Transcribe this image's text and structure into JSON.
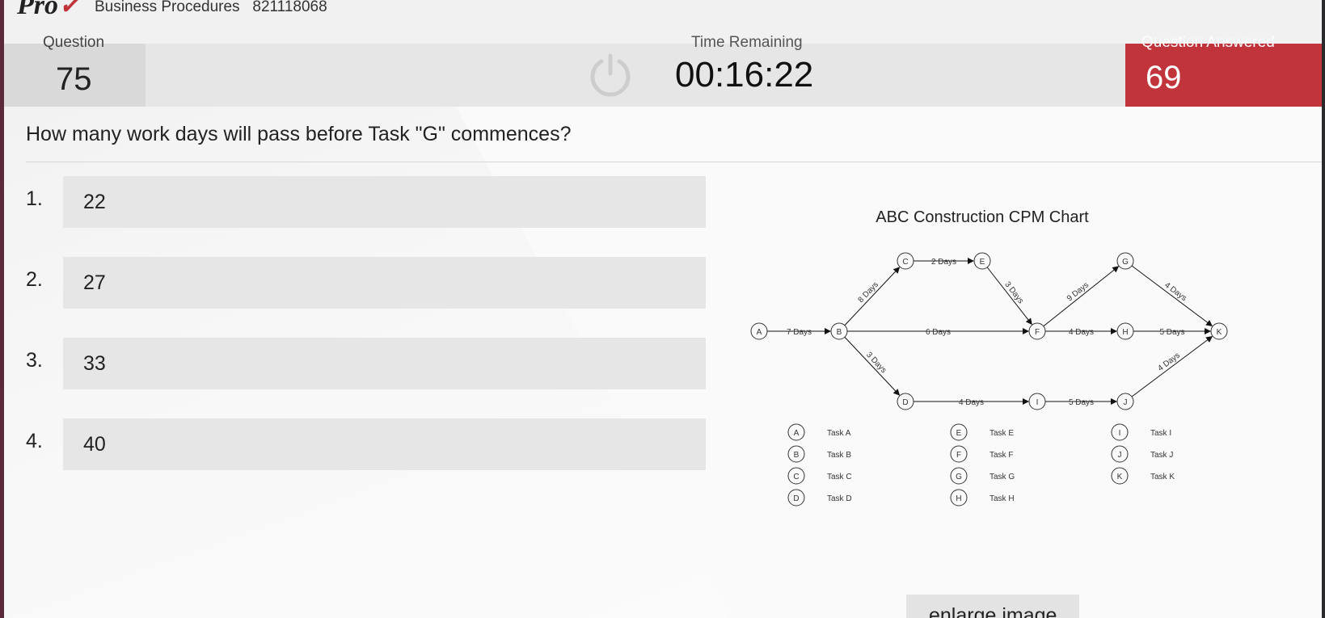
{
  "header": {
    "logo": "Pro",
    "exam_name": "Business Procedures   821118068"
  },
  "status": {
    "question_label": "Question",
    "question_number": "75",
    "time_label": "Time Remaining",
    "time_remaining": "00:16:22",
    "answered_label": "Question Answered",
    "answered_count": "69",
    "answered_color": "#c1343b"
  },
  "question": {
    "text": "How many work days will pass before Task \"G\" commences?"
  },
  "options": [
    {
      "num": "1.",
      "text": "22"
    },
    {
      "num": "2.",
      "text": "27"
    },
    {
      "num": "3.",
      "text": "33"
    },
    {
      "num": "4.",
      "text": "40"
    }
  ],
  "diagram": {
    "title": "ABC Construction CPM Chart",
    "nodes": [
      "A",
      "B",
      "C",
      "D",
      "E",
      "F",
      "G",
      "H",
      "I",
      "J",
      "K"
    ],
    "edges": [
      {
        "from": "A",
        "to": "B",
        "label": "7 Days"
      },
      {
        "from": "B",
        "to": "C",
        "label": "8 Days"
      },
      {
        "from": "B",
        "to": "F",
        "label": "6 Days"
      },
      {
        "from": "B",
        "to": "D",
        "label": "3 Days"
      },
      {
        "from": "C",
        "to": "E",
        "label": "2 Days"
      },
      {
        "from": "E",
        "to": "F",
        "label": "3 Days"
      },
      {
        "from": "F",
        "to": "G",
        "label": "9 Days"
      },
      {
        "from": "F",
        "to": "H",
        "label": "4 Days"
      },
      {
        "from": "G",
        "to": "K",
        "label": "4 Days"
      },
      {
        "from": "H",
        "to": "K",
        "label": "5 Days"
      },
      {
        "from": "D",
        "to": "I",
        "label": "4 Days"
      },
      {
        "from": "I",
        "to": "J",
        "label": "5 Days"
      },
      {
        "from": "J",
        "to": "K",
        "label": "4 Days"
      }
    ],
    "legend": [
      {
        "node": "A",
        "label": "Task A"
      },
      {
        "node": "B",
        "label": "Task B"
      },
      {
        "node": "C",
        "label": "Task C"
      },
      {
        "node": "D",
        "label": "Task D"
      },
      {
        "node": "E",
        "label": "Task E"
      },
      {
        "node": "F",
        "label": "Task F"
      },
      {
        "node": "G",
        "label": "Task G"
      },
      {
        "node": "H",
        "label": "Task H"
      },
      {
        "node": "I",
        "label": "Task I"
      },
      {
        "node": "J",
        "label": "Task J"
      },
      {
        "node": "K",
        "label": "Task K"
      }
    ]
  },
  "enlarge_button": "enlarge image"
}
